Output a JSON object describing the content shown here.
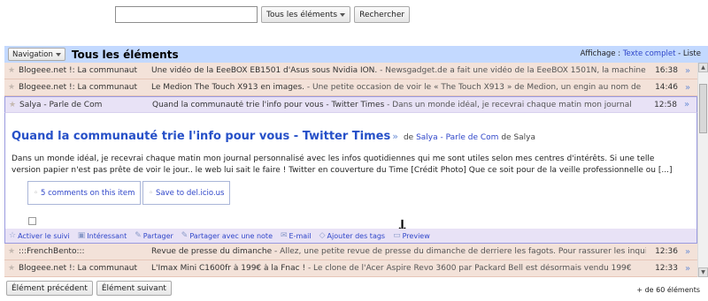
{
  "search": {
    "value": "",
    "scope_label": "Tous les éléments",
    "button_label": "Rechercher"
  },
  "header": {
    "nav_label": "Navigation",
    "title": "Tous les éléments",
    "display_label": "Affichage :",
    "full_text_label": "Texte complet",
    "separator": " - ",
    "list_label": "Liste"
  },
  "rows": [
    {
      "star": "★",
      "source": "Blogeee.net !: La communaut",
      "title": "Une vidéo de la EeeBOX EB1501 d'Asus sous Nvidia ION.",
      "snippet": " - Newsgadget.de a fait une vidéo de la EeeBOX 1501N, la machine",
      "date": "16:38"
    },
    {
      "star": "★",
      "source": "Blogeee.net !: La communaut",
      "title": "Le Medion The Touch X913 en images.",
      "snippet": " - Une petite occasion de voir le « The Touch X913 » de Medion, un engin au nom de",
      "date": "14:46"
    }
  ],
  "active_row": {
    "star": "★",
    "source": "Salya - Parle de Com",
    "title": "Quand la communauté trie l'info pour vous - Twitter Times",
    "snippet": " - Dans un monde idéal, je recevrai chaque matin mon journal",
    "date": "12:58"
  },
  "entry": {
    "title": "Quand la communauté trie l'info pour vous - Twitter Times",
    "by_prefix": "de",
    "author_link": "Salya - Parle de Com",
    "by_mid": "de",
    "author": "Salya",
    "body": "Dans un monde idéal, je recevrai chaque matin mon journal personnalisé avec les infos quotidiennes qui me sont utiles selon mes centres d'intérêts. Si une telle version papier n'est pas prête de voir le jour.. le web lui sait le faire ! Twitter en couverture du Time [Crédit Photo] Que ce soit pour de la veille professionnelle ou [...]",
    "share_comments": "5 comments on this item",
    "share_delicious": "Save to del.icio.us",
    "arrow": "↓",
    "actions": [
      {
        "icon": "☆",
        "label": "Activer le suivi"
      },
      {
        "icon": "▣",
        "label": "Intéressant"
      },
      {
        "icon": "✎",
        "label": "Partager"
      },
      {
        "icon": "✎",
        "label": "Partager avec une note"
      },
      {
        "icon": "✉",
        "label": "E-mail"
      },
      {
        "icon": "◇",
        "label": "Ajouter des tags"
      },
      {
        "icon": "▭",
        "label": "Preview"
      }
    ]
  },
  "rows_after": [
    {
      "star": "★",
      "source": ":::FrenchBento:::",
      "title": "Revue de presse du dimanche",
      "snippet": " - Allez, une petite revue de presse du dimanche de derriere les fagots. Pour rassurer les inquiets,",
      "date": "12:36"
    },
    {
      "star": "★",
      "source": "Blogeee.net !: La communaut",
      "title": "L'Imax Mini C1600fr à 199€ à la Fnac !",
      "snippet": " - Le clone de l'Acer Aspire Revo 3600 par Packard Bell est désormais vendu 199€",
      "date": "12:33"
    }
  ],
  "footer": {
    "prev_label": "Élément précédent",
    "next_label": "Élément suivant",
    "count": "+ de 60 éléments"
  },
  "colors": {
    "header_bg": "#c3d9ff",
    "read_row_bg": "#f3e2d9",
    "active_row_bg": "#e8e2f6",
    "link": "#2f46c9",
    "title_link": "#2650c8"
  }
}
